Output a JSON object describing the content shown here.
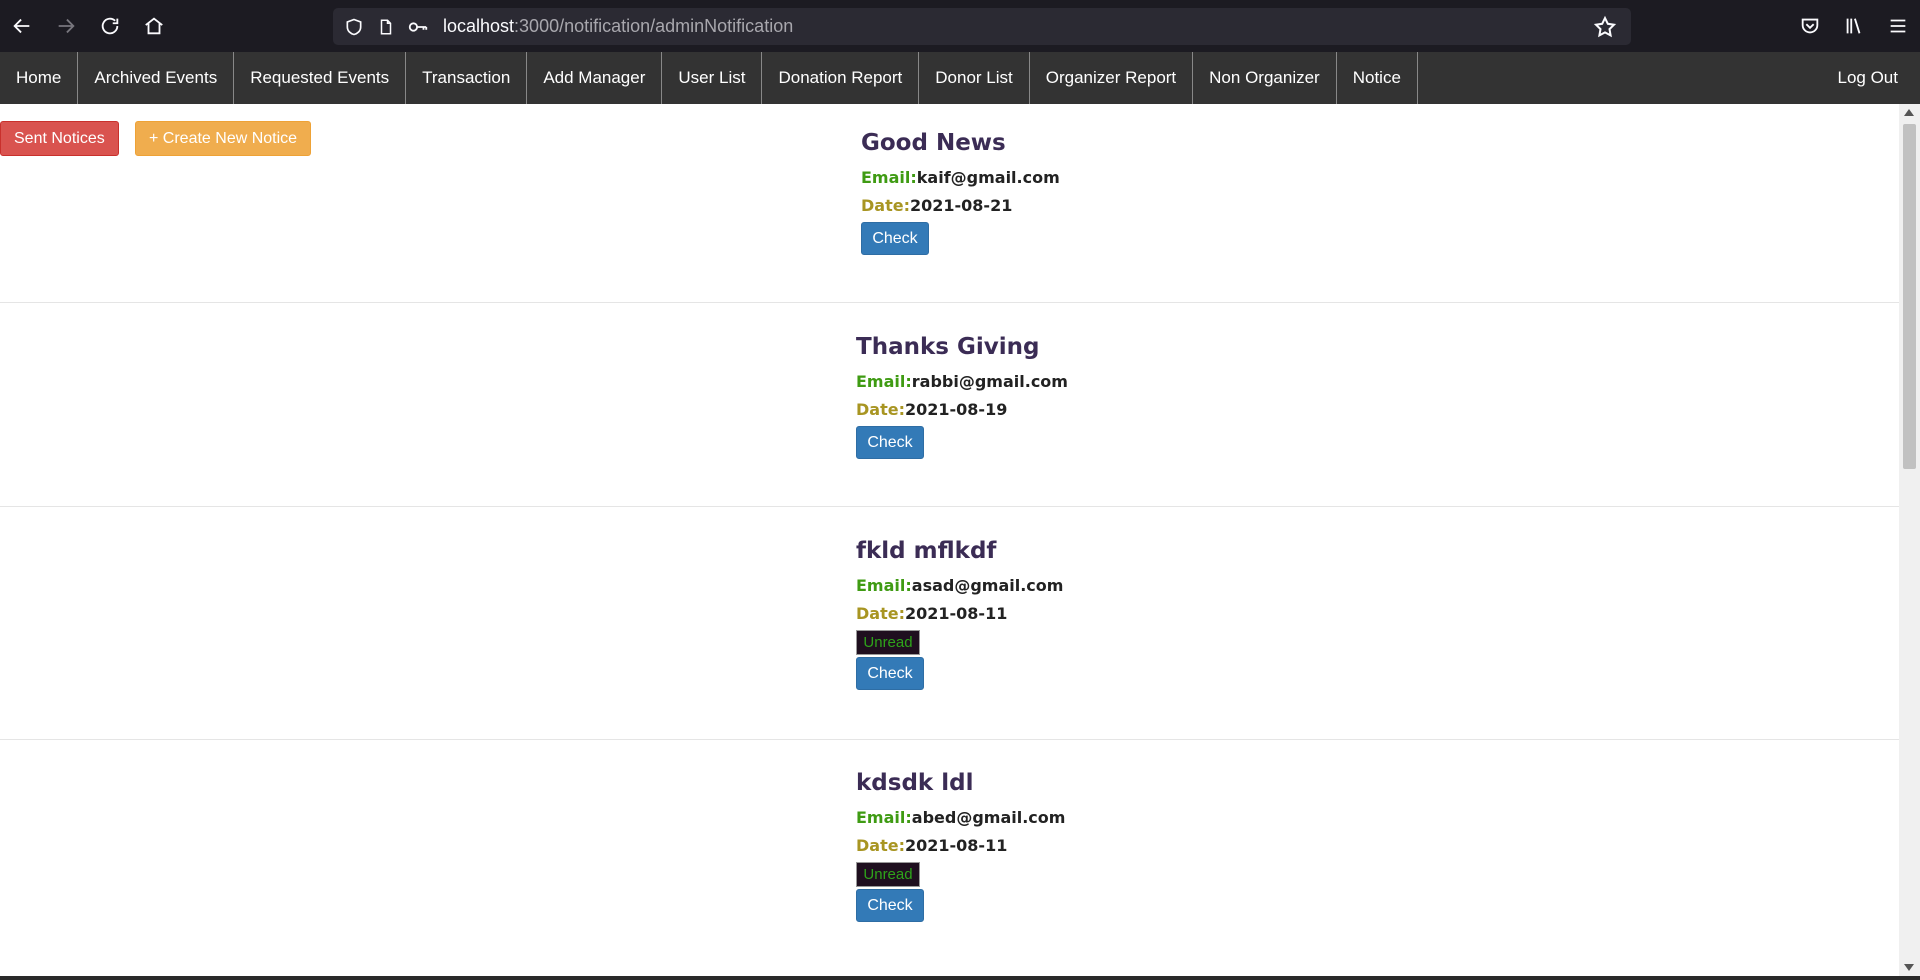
{
  "browser": {
    "url_host": "localhost",
    "url_path": ":3000/notification/adminNotification"
  },
  "nav": {
    "items": [
      "Home",
      "Archived Events",
      "Requested Events",
      "Transaction",
      "Add Manager",
      "User List",
      "Donation Report",
      "Donor List",
      "Organizer Report",
      "Non Organizer",
      "Notice"
    ],
    "logout": "Log Out"
  },
  "actions": {
    "sent_notices": "Sent Notices",
    "create_notice": "+ Create New Notice"
  },
  "labels": {
    "email": "Email:",
    "date": "Date:",
    "check": "Check",
    "unread": "Unread"
  },
  "notices": [
    {
      "title": "Good News",
      "email": "kaif@gmail.com",
      "date": "2021-08-21",
      "unread": false
    },
    {
      "title": "Thanks Giving",
      "email": "rabbi@gmail.com",
      "date": "2021-08-19",
      "unread": false
    },
    {
      "title": "fkld mflkdf",
      "email": "asad@gmail.com",
      "date": "2021-08-11",
      "unread": true
    },
    {
      "title": "kdsdk ldl",
      "email": "abed@gmail.com",
      "date": "2021-08-11",
      "unread": true
    }
  ],
  "colors": {
    "navbar": "#333333",
    "title": "#3b2c55",
    "email_label": "#3f9b13",
    "date_label": "#a89522",
    "check_button": "#337ab7"
  }
}
